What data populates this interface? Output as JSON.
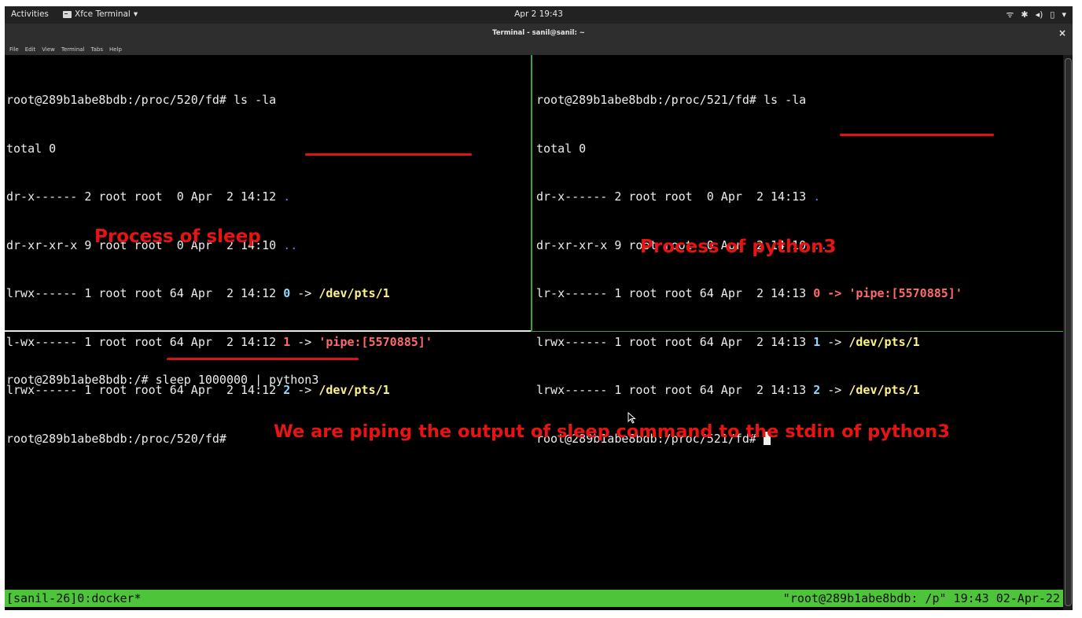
{
  "topbar": {
    "activities": "Activities",
    "app_name": "Xfce Terminal",
    "app_caret": "▾",
    "clock": "Apr 2 19:43",
    "tray_icons": [
      "wifi-icon",
      "bluetooth-icon",
      "volume-icon",
      "battery-icon",
      "chevron-down-icon"
    ],
    "tray_glyphs": [
      "ᯤ",
      "✱",
      "◂)",
      "▯",
      "▾"
    ]
  },
  "window": {
    "title": "Terminal - sanil@sanil: ~",
    "close_glyph": "×"
  },
  "menubar": [
    "File",
    "Edit",
    "View",
    "Terminal",
    "Tabs",
    "Help"
  ],
  "pane_left": {
    "prompt_cmd": "root@289b1abe8bdb:/proc/520/fd# ls -la",
    "total": "total 0",
    "rows": [
      {
        "meta": "dr-x------ 2 root root  0 Apr  2 14:12 ",
        "name": "."
      },
      {
        "meta": "dr-xr-xr-x 9 root root  0 Apr  2 14:10 ",
        "name": ".."
      },
      {
        "meta": "lrwx------ 1 root root 64 Apr  2 14:12 ",
        "fd": "0",
        "arrow": " -> ",
        "target": "/dev/pts/1"
      },
      {
        "meta": "l-wx------ 1 root root 64 Apr  2 14:12 ",
        "fd": "1",
        "arrow": " -> ",
        "target": "'pipe:[5570885]'"
      },
      {
        "meta": "lrwx------ 1 root root 64 Apr  2 14:12 ",
        "fd": "2",
        "arrow": " -> ",
        "target": "/dev/pts/1"
      }
    ],
    "prompt_end": "root@289b1abe8bdb:/proc/520/fd# ",
    "annotation": "Process of sleep"
  },
  "pane_right": {
    "prompt_cmd": "root@289b1abe8bdb:/proc/521/fd# ls -la",
    "total": "total 0",
    "rows": [
      {
        "meta": "dr-x------ 2 root root  0 Apr  2 14:13 ",
        "name": "."
      },
      {
        "meta": "dr-xr-xr-x 9 root root  0 Apr  2 14:10 ",
        "name": ".."
      },
      {
        "meta": "lr-x------ 1 root root 64 Apr  2 14:13 ",
        "fd": "0",
        "arrow": " -> ",
        "target": "'pipe:[5570885]'"
      },
      {
        "meta": "lrwx------ 1 root root 64 Apr  2 14:13 ",
        "fd": "1",
        "arrow": " -> ",
        "target": "/dev/pts/1"
      },
      {
        "meta": "lrwx------ 1 root root 64 Apr  2 14:13 ",
        "fd": "2",
        "arrow": " -> ",
        "target": "/dev/pts/1"
      }
    ],
    "prompt_end": "root@289b1abe8bdb:/proc/521/fd# ",
    "annotation": "Process of python3"
  },
  "pane_bottom": {
    "prompt": "root@289b1abe8bdb:/# ",
    "command": "sleep 1000000 | python3",
    "annotation": "We are piping the output of sleep command to the stdin of python3"
  },
  "status": {
    "left": "[sanil-26]0:docker*",
    "right": "\"root@289b1abe8bdb: /p\" 19:43 02-Apr-22"
  },
  "colors": {
    "terminal_bg": "#000000",
    "annotation_red": "#e81414",
    "status_green": "#4dc43a",
    "pane_border_green": "#3aa33a"
  }
}
